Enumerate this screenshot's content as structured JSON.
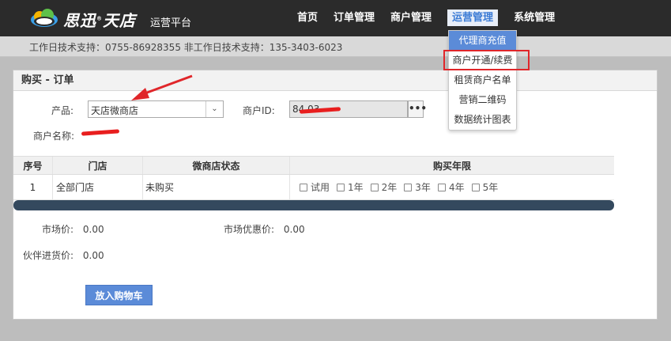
{
  "header": {
    "brand": "思迅",
    "brand_product": "天店",
    "brand_sub": "运营平台",
    "nav": [
      {
        "label": "首页"
      },
      {
        "label": "订单管理"
      },
      {
        "label": "商户管理"
      },
      {
        "label": "运营管理"
      },
      {
        "label": "系统管理"
      }
    ]
  },
  "support": {
    "text": "工作日技术支持：0755-86928355    非工作日技术支持：135-3403-6023"
  },
  "dropdown": {
    "items": [
      {
        "label": "代理商充值"
      },
      {
        "label": "商户开通/续费"
      },
      {
        "label": "租赁商户名单"
      },
      {
        "label": "营销二维码"
      },
      {
        "label": "数据统计图表"
      }
    ]
  },
  "panel": {
    "title": "购买 - 订单",
    "product_label": "产品:",
    "product_value": "天店微商店",
    "merchant_id_label": "商户ID:",
    "merchant_id_value": "84   03",
    "more_label": "•••",
    "merchant_name_label": "商户名称:"
  },
  "table": {
    "headers": [
      "序号",
      "门店",
      "微商店状态",
      "购买年限"
    ],
    "rows": [
      {
        "index": "1",
        "store": "全部门店",
        "status": "未购买"
      }
    ],
    "years": [
      "试用",
      "1年",
      "2年",
      "3年",
      "4年",
      "5年"
    ]
  },
  "prices": {
    "market_label": "市场价:",
    "market_value": "0.00",
    "discount_label": "市场优惠价:",
    "discount_value": "0.00",
    "partner_label": "伙伴进货价:",
    "partner_value": "0.00"
  },
  "cart_button": "放入购物车",
  "colors": {
    "accent": "#5b8bd8",
    "nav_bg": "#2b2b2b",
    "highlight_red": "#e0262a"
  }
}
